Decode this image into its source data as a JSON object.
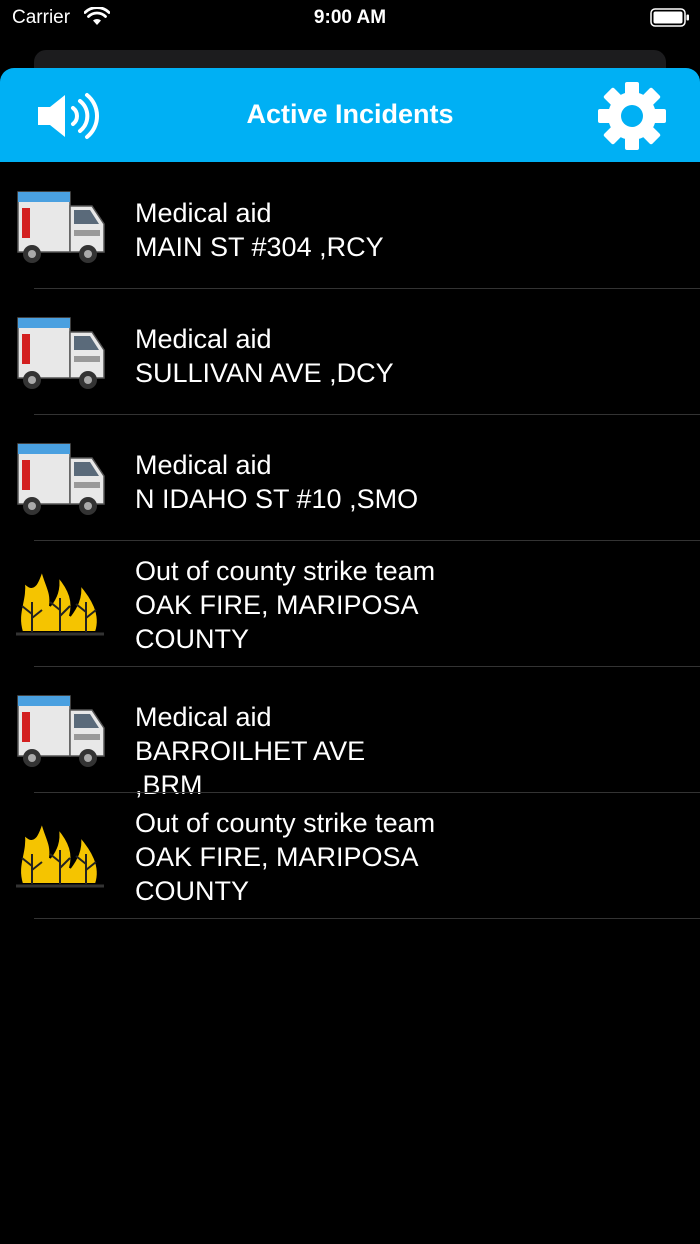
{
  "status_bar": {
    "carrier": "Carrier",
    "time": "9:00 AM"
  },
  "navbar": {
    "title": "Active Incidents",
    "background": "#00b0f4"
  },
  "incidents": [
    {
      "type": "Medical aid",
      "location": "MAIN ST #304 ,RCY",
      "icon": "ambulance-icon"
    },
    {
      "type": "Medical aid",
      "location": "SULLIVAN AVE ,DCY",
      "icon": "ambulance-icon"
    },
    {
      "type": "Medical aid",
      "location": "N IDAHO ST #10 ,SMO",
      "icon": "ambulance-icon"
    },
    {
      "type": "Out of county strike team",
      "location": "OAK FIRE, MARIPOSA COUNTY",
      "icon": "fire-icon"
    },
    {
      "type": "Medical aid",
      "location": "BARROILHET AVE ,BRM",
      "icon": "ambulance-icon"
    },
    {
      "type": "Out of county strike team",
      "location": "OAK FIRE, MARIPOSA COUNTY",
      "icon": "fire-icon"
    }
  ]
}
